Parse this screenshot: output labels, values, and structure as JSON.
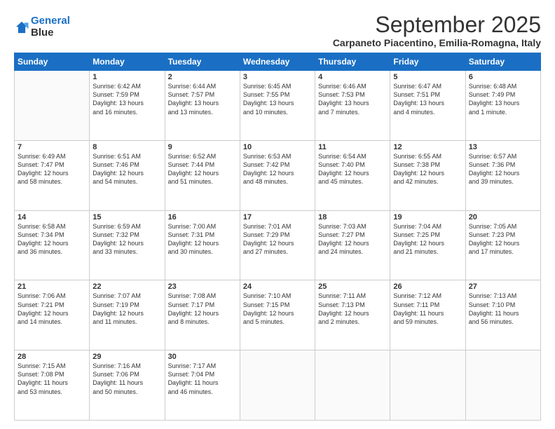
{
  "logo": {
    "line1": "General",
    "line2": "Blue"
  },
  "title": "September 2025",
  "subtitle": "Carpaneto Piacentino, Emilia-Romagna, Italy",
  "days_header": [
    "Sunday",
    "Monday",
    "Tuesday",
    "Wednesday",
    "Thursday",
    "Friday",
    "Saturday"
  ],
  "weeks": [
    [
      {
        "day": "",
        "info": ""
      },
      {
        "day": "1",
        "info": "Sunrise: 6:42 AM\nSunset: 7:59 PM\nDaylight: 13 hours\nand 16 minutes."
      },
      {
        "day": "2",
        "info": "Sunrise: 6:44 AM\nSunset: 7:57 PM\nDaylight: 13 hours\nand 13 minutes."
      },
      {
        "day": "3",
        "info": "Sunrise: 6:45 AM\nSunset: 7:55 PM\nDaylight: 13 hours\nand 10 minutes."
      },
      {
        "day": "4",
        "info": "Sunrise: 6:46 AM\nSunset: 7:53 PM\nDaylight: 13 hours\nand 7 minutes."
      },
      {
        "day": "5",
        "info": "Sunrise: 6:47 AM\nSunset: 7:51 PM\nDaylight: 13 hours\nand 4 minutes."
      },
      {
        "day": "6",
        "info": "Sunrise: 6:48 AM\nSunset: 7:49 PM\nDaylight: 13 hours\nand 1 minute."
      }
    ],
    [
      {
        "day": "7",
        "info": "Sunrise: 6:49 AM\nSunset: 7:47 PM\nDaylight: 12 hours\nand 58 minutes."
      },
      {
        "day": "8",
        "info": "Sunrise: 6:51 AM\nSunset: 7:46 PM\nDaylight: 12 hours\nand 54 minutes."
      },
      {
        "day": "9",
        "info": "Sunrise: 6:52 AM\nSunset: 7:44 PM\nDaylight: 12 hours\nand 51 minutes."
      },
      {
        "day": "10",
        "info": "Sunrise: 6:53 AM\nSunset: 7:42 PM\nDaylight: 12 hours\nand 48 minutes."
      },
      {
        "day": "11",
        "info": "Sunrise: 6:54 AM\nSunset: 7:40 PM\nDaylight: 12 hours\nand 45 minutes."
      },
      {
        "day": "12",
        "info": "Sunrise: 6:55 AM\nSunset: 7:38 PM\nDaylight: 12 hours\nand 42 minutes."
      },
      {
        "day": "13",
        "info": "Sunrise: 6:57 AM\nSunset: 7:36 PM\nDaylight: 12 hours\nand 39 minutes."
      }
    ],
    [
      {
        "day": "14",
        "info": "Sunrise: 6:58 AM\nSunset: 7:34 PM\nDaylight: 12 hours\nand 36 minutes."
      },
      {
        "day": "15",
        "info": "Sunrise: 6:59 AM\nSunset: 7:32 PM\nDaylight: 12 hours\nand 33 minutes."
      },
      {
        "day": "16",
        "info": "Sunrise: 7:00 AM\nSunset: 7:31 PM\nDaylight: 12 hours\nand 30 minutes."
      },
      {
        "day": "17",
        "info": "Sunrise: 7:01 AM\nSunset: 7:29 PM\nDaylight: 12 hours\nand 27 minutes."
      },
      {
        "day": "18",
        "info": "Sunrise: 7:03 AM\nSunset: 7:27 PM\nDaylight: 12 hours\nand 24 minutes."
      },
      {
        "day": "19",
        "info": "Sunrise: 7:04 AM\nSunset: 7:25 PM\nDaylight: 12 hours\nand 21 minutes."
      },
      {
        "day": "20",
        "info": "Sunrise: 7:05 AM\nSunset: 7:23 PM\nDaylight: 12 hours\nand 17 minutes."
      }
    ],
    [
      {
        "day": "21",
        "info": "Sunrise: 7:06 AM\nSunset: 7:21 PM\nDaylight: 12 hours\nand 14 minutes."
      },
      {
        "day": "22",
        "info": "Sunrise: 7:07 AM\nSunset: 7:19 PM\nDaylight: 12 hours\nand 11 minutes."
      },
      {
        "day": "23",
        "info": "Sunrise: 7:08 AM\nSunset: 7:17 PM\nDaylight: 12 hours\nand 8 minutes."
      },
      {
        "day": "24",
        "info": "Sunrise: 7:10 AM\nSunset: 7:15 PM\nDaylight: 12 hours\nand 5 minutes."
      },
      {
        "day": "25",
        "info": "Sunrise: 7:11 AM\nSunset: 7:13 PM\nDaylight: 12 hours\nand 2 minutes."
      },
      {
        "day": "26",
        "info": "Sunrise: 7:12 AM\nSunset: 7:11 PM\nDaylight: 11 hours\nand 59 minutes."
      },
      {
        "day": "27",
        "info": "Sunrise: 7:13 AM\nSunset: 7:10 PM\nDaylight: 11 hours\nand 56 minutes."
      }
    ],
    [
      {
        "day": "28",
        "info": "Sunrise: 7:15 AM\nSunset: 7:08 PM\nDaylight: 11 hours\nand 53 minutes."
      },
      {
        "day": "29",
        "info": "Sunrise: 7:16 AM\nSunset: 7:06 PM\nDaylight: 11 hours\nand 50 minutes."
      },
      {
        "day": "30",
        "info": "Sunrise: 7:17 AM\nSunset: 7:04 PM\nDaylight: 11 hours\nand 46 minutes."
      },
      {
        "day": "",
        "info": ""
      },
      {
        "day": "",
        "info": ""
      },
      {
        "day": "",
        "info": ""
      },
      {
        "day": "",
        "info": ""
      }
    ]
  ],
  "colors": {
    "header_bg": "#1a6fc4",
    "header_text": "#ffffff",
    "border": "#cccccc"
  }
}
